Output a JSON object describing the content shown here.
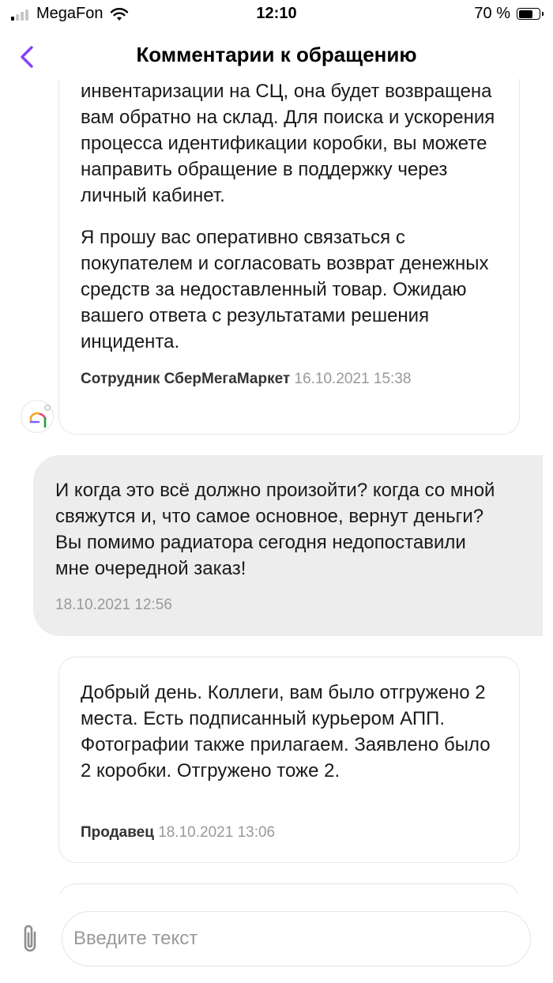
{
  "status_bar": {
    "carrier": "MegaFon",
    "time": "12:10",
    "battery_percent": "70 %",
    "battery_level": 0.7
  },
  "header": {
    "title": "Комментарии к обращению"
  },
  "messages": [
    {
      "paragraphs": [
        "инвентаризации на СЦ, она будет возвращена вам обратно на склад. Для поиска и ускорения процесса идентификации коробки, вы можете направить обращение в поддержку через личный кабинет.",
        "Я прошу вас оперативно связаться с покупателем и согласовать возврат денежных средств за недоставленный товар. Ожидаю вашего ответа с результатами решения инцидента."
      ],
      "author": "Сотрудник СберМегаМаркет",
      "time": "16.10.2021 15:38"
    },
    {
      "text": "И когда это всё должно произойти? когда со мной свяжутся и, что самое основное, вернут деньги? Вы помимо радиатора сегодня недопоставили мне очередной заказ!",
      "time": "18.10.2021 12:56"
    },
    {
      "text": "Добрый день. Коллеги, вам было отгружено 2 места. Есть подписанный курьером АПП. Фотографии также прилагаем. Заявлено было 2 коробки. Отгружено тоже 2.",
      "author": "Продавец",
      "time": "18.10.2021 13:06"
    }
  ],
  "composer": {
    "placeholder": "Введите текст"
  },
  "colors": {
    "accent": "#8a3ffc",
    "user_bubble": "#ededed",
    "muted": "#999999"
  },
  "icons": [
    "back-chevron-icon",
    "paperclip-icon",
    "sbermegamarket-logo-icon"
  ]
}
